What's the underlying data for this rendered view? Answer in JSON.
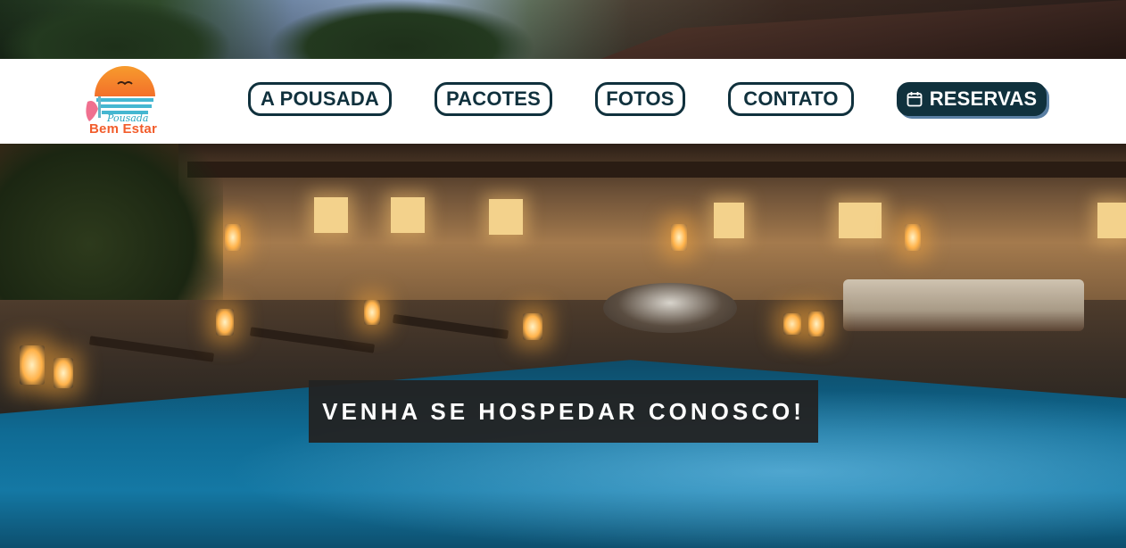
{
  "brand": {
    "script": "Pousada",
    "name": "Bem Estar",
    "logo_icon": "sunset-beach-logo-icon"
  },
  "nav": {
    "items": [
      {
        "label": "A POUSADA"
      },
      {
        "label": "PACOTES"
      },
      {
        "label": "FOTOS"
      },
      {
        "label": "CONTATO"
      }
    ],
    "reservations": {
      "label": "RESERVAS",
      "icon": "calendar-icon"
    }
  },
  "hero": {
    "caption": "VENHA SE HOSPEDAR CONOSCO!",
    "image": "night-pool-lodge-photo"
  },
  "colors": {
    "nav_dark": "#10313d",
    "reservations_shadow": "#5a7fa3",
    "caption_bg": "#232323",
    "logo_orange": "#f25d2c",
    "logo_blue": "#2aa6c0"
  }
}
